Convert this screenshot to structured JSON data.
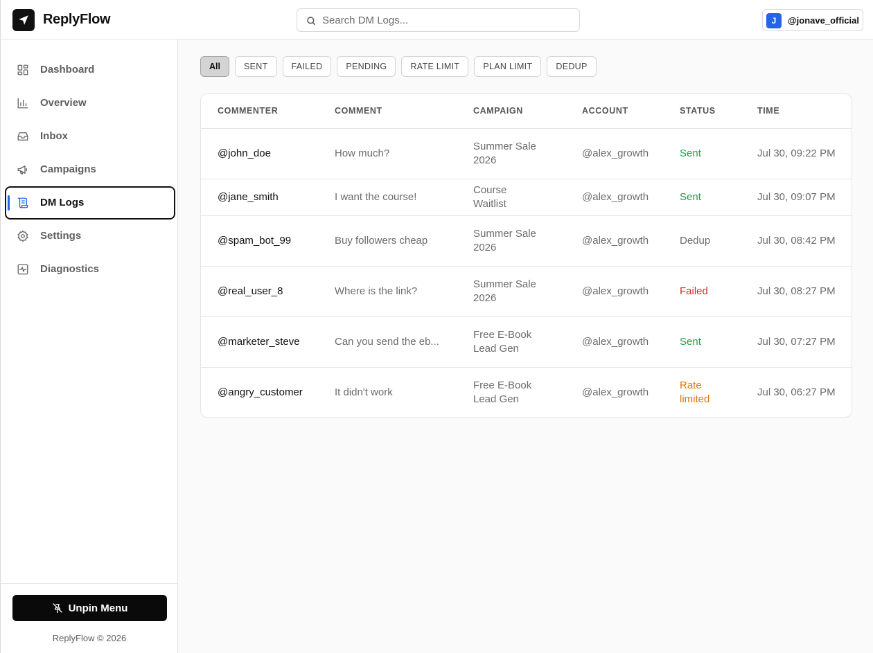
{
  "header": {
    "app_name": "ReplyFlow",
    "search_placeholder": "Search DM Logs...",
    "account": {
      "avatar_letter": "J",
      "handle": "@jonave_official",
      "avatar_color": "#2563eb"
    }
  },
  "sidebar": {
    "items": [
      {
        "label": "Dashboard",
        "icon": "dashboard-icon"
      },
      {
        "label": "Overview",
        "icon": "bar-chart-icon"
      },
      {
        "label": "Inbox",
        "icon": "inbox-icon"
      },
      {
        "label": "Campaigns",
        "icon": "megaphone-icon"
      },
      {
        "label": "DM Logs",
        "icon": "scroll-icon",
        "active": true
      },
      {
        "label": "Settings",
        "icon": "gear-icon"
      },
      {
        "label": "Diagnostics",
        "icon": "activity-icon"
      }
    ],
    "unpin_label": "Unpin Menu",
    "copyright": "ReplyFlow © 2026"
  },
  "filters": {
    "items": [
      "All",
      "SENT",
      "FAILED",
      "PENDING",
      "RATE LIMIT",
      "PLAN LIMIT",
      "DEDUP"
    ],
    "active": "All"
  },
  "table": {
    "columns": [
      "COMMENTER",
      "COMMENT",
      "CAMPAIGN",
      "ACCOUNT",
      "STATUS",
      "TIME"
    ],
    "rows": [
      {
        "commenter": "@john_doe",
        "comment": "How much?",
        "campaign": "Summer Sale 2026",
        "account": "@alex_growth",
        "status": "Sent",
        "time": "Jul 30, 09:22 PM"
      },
      {
        "commenter": "@jane_smith",
        "comment": "I want the course!",
        "campaign": "Course Waitlist",
        "account": "@alex_growth",
        "status": "Sent",
        "time": "Jul 30, 09:07 PM"
      },
      {
        "commenter": "@spam_bot_99",
        "comment": "Buy followers cheap",
        "campaign": "Summer Sale 2026",
        "account": "@alex_growth",
        "status": "Dedup",
        "time": "Jul 30, 08:42 PM"
      },
      {
        "commenter": "@real_user_8",
        "comment": "Where is the link?",
        "campaign": "Summer Sale 2026",
        "account": "@alex_growth",
        "status": "Failed",
        "time": "Jul 30, 08:27 PM"
      },
      {
        "commenter": "@marketer_steve",
        "comment": "Can you send the eb...",
        "campaign": "Free E-Book Lead Gen",
        "account": "@alex_growth",
        "status": "Sent",
        "time": "Jul 30, 07:27 PM"
      },
      {
        "commenter": "@angry_customer",
        "comment": "It didn't work",
        "campaign": "Free E-Book Lead Gen",
        "account": "@alex_growth",
        "status": "Rate limited",
        "time": "Jul 30, 06:27 PM"
      }
    ]
  },
  "colors": {
    "status_sent": "#16a34a",
    "status_failed": "#dc2626",
    "status_rate_limited": "#d97706",
    "status_dedup": "#6b6b6b",
    "accent": "#2563eb"
  }
}
